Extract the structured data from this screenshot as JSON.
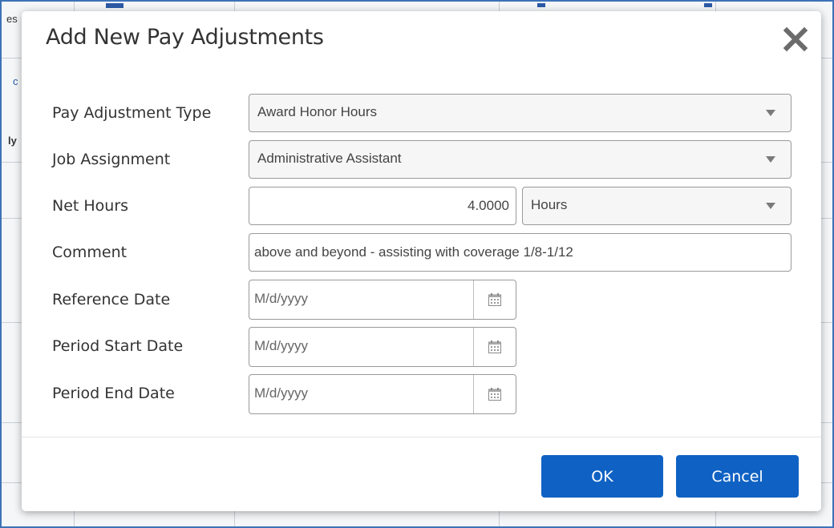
{
  "dialog": {
    "title": "Add New Pay Adjustments",
    "fields": {
      "pay_adjustment_type": {
        "label": "Pay Adjustment Type",
        "value": "Award Honor Hours"
      },
      "job_assignment": {
        "label": "Job Assignment",
        "value": "Administrative Assistant"
      },
      "net_hours": {
        "label": "Net Hours",
        "value": "4.0000",
        "unit": "Hours"
      },
      "comment": {
        "label": "Comment",
        "value": "above and beyond - assisting with coverage 1/8-1/12"
      },
      "reference_date": {
        "label": "Reference Date",
        "placeholder": "M/d/yyyy"
      },
      "period_start_date": {
        "label": "Period Start Date",
        "placeholder": "M/d/yyyy"
      },
      "period_end_date": {
        "label": "Period End Date",
        "placeholder": "M/d/yyyy"
      }
    },
    "buttons": {
      "ok": "OK",
      "cancel": "Cancel"
    }
  },
  "background": {
    "fragments": [
      "es",
      "c",
      "ly"
    ]
  },
  "colors": {
    "primary_button": "#0f62c4",
    "frame_border": "#3d72b8"
  }
}
